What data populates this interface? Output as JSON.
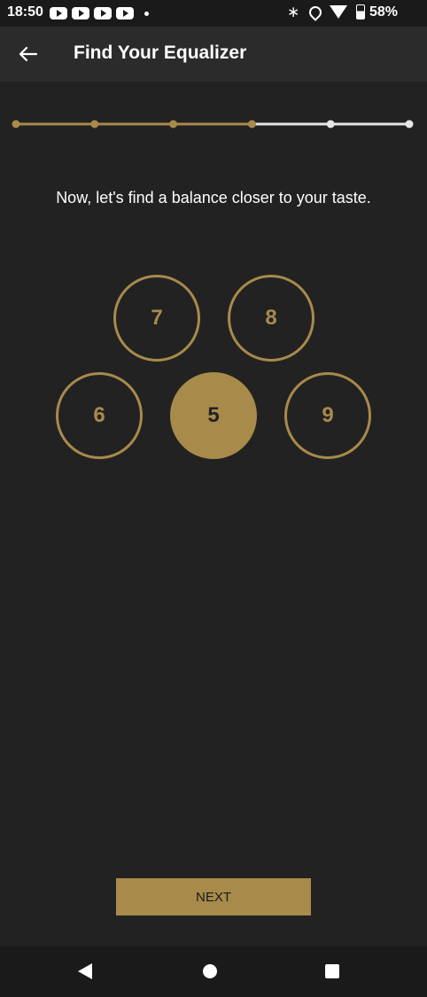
{
  "status_bar": {
    "time": "18:50",
    "notifications": [
      "youtube-icon",
      "youtube-icon",
      "youtube-icon",
      "youtube-icon",
      "dot-icon"
    ],
    "battery": "58%",
    "battery_level": 0.58
  },
  "header": {
    "back_icon": "arrow-left-icon",
    "title": "Find Your Equalizer"
  },
  "progress": {
    "total_steps": 6,
    "current_step": 4,
    "active_color": "#a88a4b",
    "inactive_color": "#e6e6e6"
  },
  "prompt": "Now, let's find a balance closer to your taste.",
  "options": [
    {
      "label": "7",
      "selected": false
    },
    {
      "label": "8",
      "selected": false
    },
    {
      "label": "6",
      "selected": false
    },
    {
      "label": "5",
      "selected": true
    },
    {
      "label": "9",
      "selected": false
    }
  ],
  "next_label": "NEXT",
  "nav_bar": {
    "back_icon": "triangle-back-icon",
    "home_icon": "circle-home-icon",
    "recents_icon": "square-recents-icon"
  },
  "colors": {
    "accent": "#a88a4b",
    "background": "#222222",
    "app_bar": "#2b2b2b"
  }
}
